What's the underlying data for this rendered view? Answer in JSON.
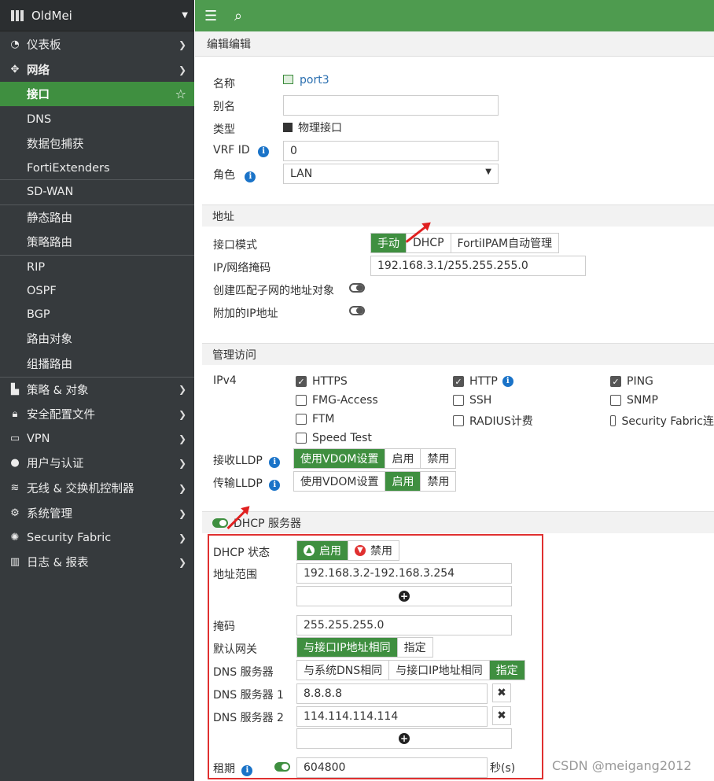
{
  "sidebar": {
    "brand": "OldMei",
    "items": [
      {
        "label": "仪表板",
        "icon": "dashboard-icon"
      },
      {
        "label": "网络",
        "icon": "network-icon"
      },
      {
        "label": "接口"
      },
      {
        "label": "DNS"
      },
      {
        "label": "数据包捕获"
      },
      {
        "label": "FortiExtenders"
      },
      {
        "label": "SD-WAN"
      },
      {
        "label": "静态路由"
      },
      {
        "label": "策略路由"
      },
      {
        "label": "RIP"
      },
      {
        "label": "OSPF"
      },
      {
        "label": "BGP"
      },
      {
        "label": "路由对象"
      },
      {
        "label": "组播路由"
      },
      {
        "label": "策略 & 对象",
        "icon": "policy-icon"
      },
      {
        "label": "安全配置文件",
        "icon": "lock-icon"
      },
      {
        "label": "VPN",
        "icon": "laptop-icon"
      },
      {
        "label": "用户与认证",
        "icon": "user-icon"
      },
      {
        "label": "无线 & 交换机控制器",
        "icon": "wifi-icon"
      },
      {
        "label": "系统管理",
        "icon": "gear-icon"
      },
      {
        "label": "Security Fabric",
        "icon": "fabric-icon"
      },
      {
        "label": "日志 & 报表",
        "icon": "chart-icon"
      }
    ]
  },
  "breadcrumb": "编辑编辑",
  "form": {
    "name_label": "名称",
    "name_value": "port3",
    "alias_label": "别名",
    "alias_value": "",
    "type_label": "类型",
    "type_value": "物理接口",
    "vrf_label": "VRF ID",
    "vrf_value": "0",
    "role_label": "角色",
    "role_value": "LAN"
  },
  "address": {
    "section_title": "地址",
    "mode_label": "接口模式",
    "modes": [
      "手动",
      "DHCP",
      "FortiIPAM自动管理"
    ],
    "ip_label": "IP/网络掩码",
    "ip_value": "192.168.3.1/255.255.255.0",
    "create_obj_label": "创建匹配子网的地址对象",
    "extra_ip_label": "附加的IP地址"
  },
  "admin": {
    "section_title": "管理访问",
    "ipv4_label": "IPv4",
    "checkboxes": [
      {
        "label": "HTTPS",
        "checked": true
      },
      {
        "label": "HTTP",
        "checked": true
      },
      {
        "label": "PING",
        "checked": true
      },
      {
        "label": "FMG-Access",
        "checked": false
      },
      {
        "label": "SSH",
        "checked": false
      },
      {
        "label": "SNMP",
        "checked": false
      },
      {
        "label": "FTM",
        "checked": false
      },
      {
        "label": "RADIUS计费",
        "checked": false
      },
      {
        "label": "Security Fabric连",
        "checked": false
      },
      {
        "label": "Speed Test",
        "checked": false
      }
    ],
    "lldp_rx_label": "接收LLDP",
    "lldp_tx_label": "传输LLDP",
    "lldp_options": [
      "使用VDOM设置",
      "启用",
      "禁用"
    ]
  },
  "dhcp": {
    "section_title": "DHCP 服务器",
    "status_label": "DHCP 状态",
    "status_enable": "启用",
    "status_disable": "禁用",
    "range_label": "地址范围",
    "range_value": "192.168.3.2-192.168.3.254",
    "mask_label": "掩码",
    "mask_value": "255.255.255.0",
    "gateway_label": "默认网关",
    "gateway_options": [
      "与接口IP地址相同",
      "指定"
    ],
    "dns_label": "DNS 服务器",
    "dns_options": [
      "与系统DNS相同",
      "与接口IP地址相同",
      "指定"
    ],
    "dns1_label": "DNS 服务器 1",
    "dns1_value": "8.8.8.8",
    "dns2_label": "DNS 服务器 2",
    "dns2_value": "114.114.114.114",
    "lease_label": "租期",
    "lease_value": "604800",
    "lease_unit": "秒(s)"
  },
  "watermark": "CSDN @meigang2012",
  "colors": {
    "accent": "#3f8f40",
    "sidebar": "#363a3d",
    "highlight_box": "#e03030"
  }
}
